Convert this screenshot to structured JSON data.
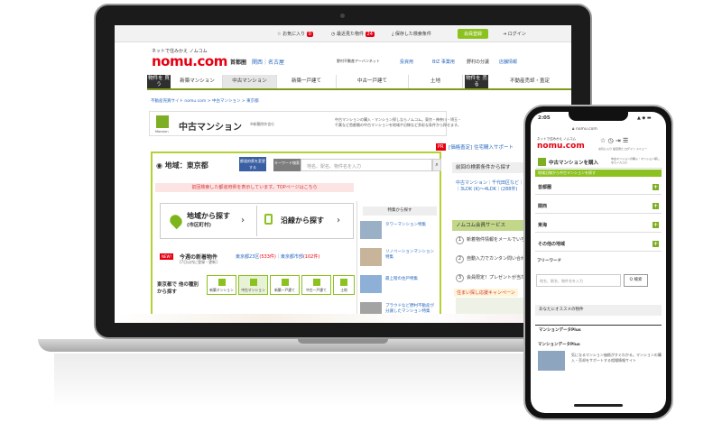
{
  "laptop": {
    "topbar": {
      "favorites_label": "お気に入り",
      "favorites_count": "0",
      "recent_label": "最近見た物件",
      "recent_count": "24",
      "saved_label": "保存した検索条件",
      "register_label": "会員登録",
      "login_label": "ログイン"
    },
    "header": {
      "logo_tagline": "ネットで住みかえ ノムコム",
      "logo": "nomu.com",
      "region_main": "首都圏",
      "region_links": "関西｜名古屋",
      "company_label": "野村不動産アーバンネット",
      "link_investment": "投資用",
      "link_business": "BIZ 事業用",
      "link_nomura": "野村の分譲",
      "link_stores": "店舗情報"
    },
    "nav": {
      "buy_label": "物件を 買う",
      "items": [
        "新築マンション",
        "中古マンション",
        "新築一戸建て",
        "中古一戸建て",
        "土地"
      ],
      "sell_label": "物件を 売る",
      "sell_item": "不動産売却・査定"
    },
    "breadcrumb": "不動産売買サイト nomu.com > 中古マンション > 東京都",
    "page_title": "中古マンション",
    "page_title_icon_label": "Mansion",
    "page_title_sub": "※新築除外含む",
    "description": "中古マンションの購入・マンション探しならノムコム。東京・神奈川・埼玉・千葉など首都圏の中古マンションを地域や沿線など多彩な条件から探せます。",
    "search": {
      "area_label": "地域：東京都",
      "change_button": "都道府県を変更する",
      "keyword_label": "キーワード検索",
      "keyword_placeholder": "地名、駅名、物件名を入力",
      "notice": "前回検索した都道府県を表示しています。TOPページはこちら",
      "by_area": "地域から探す",
      "by_area_sub": "(市区町村)",
      "by_line": "沿線から探す",
      "new_badge": "NEW!",
      "new_title": "今週の新着物件",
      "new_sub": "[7日以内に登録・更新]",
      "new_link_23": "東京都23区",
      "new_count_23": "(533件)",
      "new_link_other": "東京都市部",
      "new_count_other": "(102件)",
      "other_types_label": "東京都で 他の種別から探す",
      "type_buttons": [
        "新築マンション",
        "中古マンション",
        "新築一戸建て",
        "中古一戸建て",
        "土地"
      ]
    },
    "features": {
      "header": "特集から探す",
      "items": [
        "タワーマンション特集",
        "リノベーションマンション特集",
        "最上階の住戸特集",
        "プラウドなど野村不動産が分譲したマンション特集"
      ]
    },
    "sidebar": {
      "pr_badge": "PR",
      "pr_text": "[価格査定] 住宅購入サポート",
      "history_header": "前回の検索条件から探す",
      "history_item": "中古マンション｜千代田区など｜60m2〜｜3LDK (K)〜4LDK｜(288件)",
      "member_header": "ノムコム会員サービス",
      "member_items": [
        "新着物件情報をメールでいち早くゲット！",
        "自動入力でカンタン問い合わせ",
        "会員限定！プレゼントが当たる！"
      ],
      "campaign": "住まい探し応援キャンペーン"
    }
  },
  "phone": {
    "time": "2:05",
    "status": "▲ ◆ ▬",
    "url": "nomu.com",
    "logo_tagline": "ネットで住みかえ ノムコム",
    "logo": "nomu.com",
    "icons_label": "お気に入り  最近見た  ログイン  メニュー",
    "title": "中古マンションを購入",
    "title_desc": "中古マンションの購入・マンション探しならノムコム",
    "green_bar": "地域沿線から中古マンションを探す",
    "regions": [
      "首都圏",
      "関西",
      "東海",
      "その他の地域"
    ],
    "free_word_label": "フリーワード",
    "free_word_placeholder": "地名、駅名、物件名を入力",
    "search_button": "Q 検索",
    "recommend": "あなたにオススメの物件",
    "data_plus_header": "マンションデータPlus",
    "banner_title": "マンションデータPlus",
    "banner_text": "気になるマンション価格がすぐわかる。マンションの購入・売却をサポートする相場情報サイト"
  }
}
